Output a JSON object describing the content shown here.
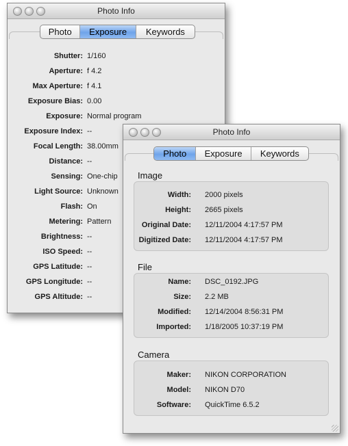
{
  "back_window": {
    "title": "Photo Info",
    "tabs": [
      "Photo",
      "Exposure",
      "Keywords"
    ],
    "active_tab": "Exposure",
    "rows": [
      {
        "label": "Shutter:",
        "value": "1/160"
      },
      {
        "label": "Aperture:",
        "value": "f 4.2"
      },
      {
        "label": "Max Aperture:",
        "value": "f 4.1"
      },
      {
        "label": "Exposure Bias:",
        "value": "0.00"
      },
      {
        "label": "Exposure:",
        "value": "Normal program"
      },
      {
        "label": "Exposure Index:",
        "value": "--"
      },
      {
        "label": "Focal Length:",
        "value": "38.00mm"
      },
      {
        "label": "Distance:",
        "value": "--"
      },
      {
        "label": "Sensing:",
        "value": "One-chip"
      },
      {
        "label": "Light Source:",
        "value": "Unknown"
      },
      {
        "label": "Flash:",
        "value": "On"
      },
      {
        "label": "Metering:",
        "value": "Pattern"
      },
      {
        "label": "Brightness:",
        "value": "--"
      },
      {
        "label": "ISO Speed:",
        "value": "--"
      },
      {
        "label": "GPS Latitude:",
        "value": "--"
      },
      {
        "label": "GPS Longitude:",
        "value": "--"
      },
      {
        "label": "GPS Altitude:",
        "value": "--"
      }
    ]
  },
  "front_window": {
    "title": "Photo Info",
    "tabs": [
      "Photo",
      "Exposure",
      "Keywords"
    ],
    "active_tab": "Photo",
    "sections": [
      {
        "title": "Image",
        "rows": [
          {
            "label": "Width:",
            "value": "2000 pixels"
          },
          {
            "label": "Height:",
            "value": "2665 pixels"
          },
          {
            "label": "Original Date:",
            "value": "12/11/2004 4:17:57 PM"
          },
          {
            "label": "Digitized Date:",
            "value": "12/11/2004 4:17:57 PM"
          }
        ]
      },
      {
        "title": "File",
        "rows": [
          {
            "label": "Name:",
            "value": "DSC_0192.JPG"
          },
          {
            "label": "Size:",
            "value": "2.2 MB"
          },
          {
            "label": "Modified:",
            "value": "12/14/2004 8:56:31 PM"
          },
          {
            "label": "Imported:",
            "value": "1/18/2005 10:37:19 PM"
          }
        ]
      },
      {
        "title": "Camera",
        "rows": [
          {
            "label": "Maker:",
            "value": "NIKON CORPORATION"
          },
          {
            "label": "Model:",
            "value": "NIKON D70"
          },
          {
            "label": "Software:",
            "value": "QuickTime 6.5.2"
          }
        ]
      }
    ]
  }
}
